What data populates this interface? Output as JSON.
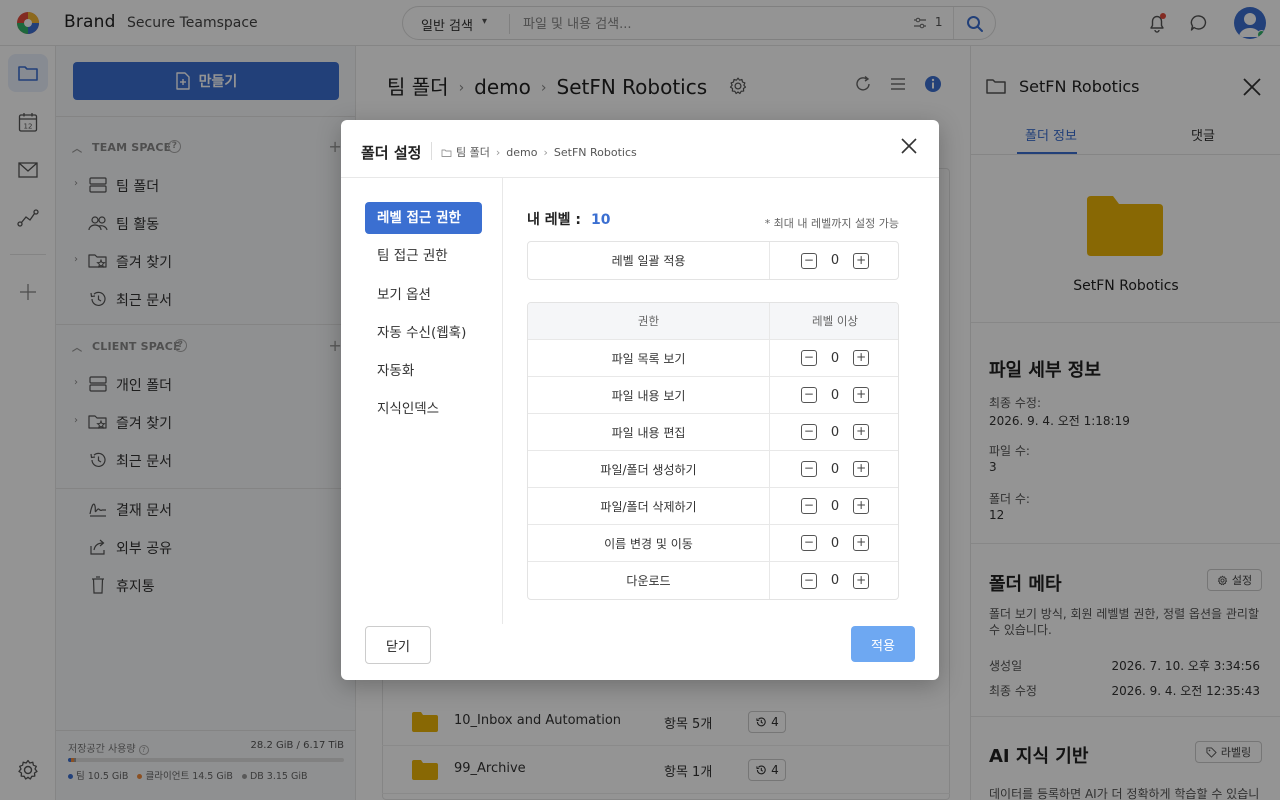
{
  "topbar": {
    "brand": "Brand",
    "brand_sub": "Secure Teamspace",
    "search_mode": "일반 검색",
    "search_placeholder": "파일 및 내용 검색...",
    "filter_count": "1"
  },
  "sidebar": {
    "create_label": "만들기",
    "team_space_label": "TEAM SPACE",
    "team_items": [
      {
        "label": "팀 폴더",
        "icon": "server-icon"
      },
      {
        "label": "팀 활동",
        "icon": "people-icon"
      },
      {
        "label": "즐겨 찾기",
        "icon": "folder-star-icon"
      },
      {
        "label": "최근 문서",
        "icon": "history-icon"
      }
    ],
    "client_space_label": "CLIENT SPACE",
    "client_items": [
      {
        "label": "개인 폴더",
        "icon": "server-icon"
      },
      {
        "label": "즐겨 찾기",
        "icon": "folder-star-icon"
      },
      {
        "label": "최근 문서",
        "icon": "history-icon"
      }
    ],
    "extra_items": [
      {
        "label": "결재 문서",
        "icon": "signature-icon"
      },
      {
        "label": "외부 공유",
        "icon": "share-icon"
      },
      {
        "label": "휴지통",
        "icon": "trash-icon"
      }
    ],
    "storage": {
      "title": "저장공간 사용량",
      "usage": "28.2 GiB / 6.17 TiB",
      "legend": [
        {
          "label": "팀 10.5 GiB",
          "color": "#3b6fd1"
        },
        {
          "label": "클라이언트 14.5 GiB",
          "color": "#f08a3c"
        },
        {
          "label": "DB 3.15 GiB",
          "color": "#999999"
        }
      ]
    }
  },
  "main": {
    "breadcrumb": [
      "팀 폴더",
      "demo",
      "SetFN Robotics"
    ],
    "rows": [
      {
        "name": "10_Inbox and Automation",
        "count": "항목 5개",
        "versions": "4"
      },
      {
        "name": "99_Archive",
        "count": "항목 1개",
        "versions": "4"
      }
    ]
  },
  "right_panel": {
    "title": "SetFN Robotics",
    "tabs": [
      "폴더 정보",
      "댓글"
    ],
    "folder_name": "SetFN Robotics",
    "details_heading": "파일 세부 정보",
    "modified_label": "최종 수정:",
    "modified_value": "2026. 9. 4. 오전 1:18:19",
    "files_label": "파일 수:",
    "files_value": "3",
    "folders_label": "폴더 수:",
    "folders_value": "12",
    "meta_heading": "폴더 메타",
    "meta_button": "설정",
    "meta_desc": "폴더 보기 방식, 회원 레벨별 권한, 정렬 옵션을 관리할 수 있습니다.",
    "created_label": "생성일",
    "created_value": "2026. 7. 10. 오후 3:34:56",
    "last_mod_label": "최종 수정",
    "last_mod_value": "2026. 9. 4. 오전 12:35:43",
    "ai_heading": "AI 지식 기반",
    "ai_button": "라벨링",
    "ai_desc": "데이터를 등록하면 AI가 더 정확하게 학습할 수 있습니"
  },
  "modal": {
    "title": "폴더 설정",
    "crumb": [
      "팀 폴더",
      "demo",
      "SetFN Robotics"
    ],
    "menu": [
      "레벨 접근 권한",
      "팀 접근 권한",
      "보기 옵션",
      "자동 수신(웹훅)",
      "자동화",
      "지식인덱스"
    ],
    "my_level_label": "내 레벨 :",
    "my_level_value": "10",
    "note": "* 최대 내 레벨까지 설정 가능",
    "bulk_label": "레벨 일괄 적용",
    "bulk_value": "0",
    "col_perm": "권한",
    "col_level": "레벨 이상",
    "perms": [
      {
        "label": "파일 목록 보기",
        "value": "0"
      },
      {
        "label": "파일 내용 보기",
        "value": "0"
      },
      {
        "label": "파일 내용 편집",
        "value": "0"
      },
      {
        "label": "파일/폴더 생성하기",
        "value": "0"
      },
      {
        "label": "파일/폴더 삭제하기",
        "value": "0"
      },
      {
        "label": "이름 변경 및 이동",
        "value": "0"
      },
      {
        "label": "다운로드",
        "value": "0"
      }
    ],
    "close_label": "닫기",
    "apply_label": "적용"
  }
}
